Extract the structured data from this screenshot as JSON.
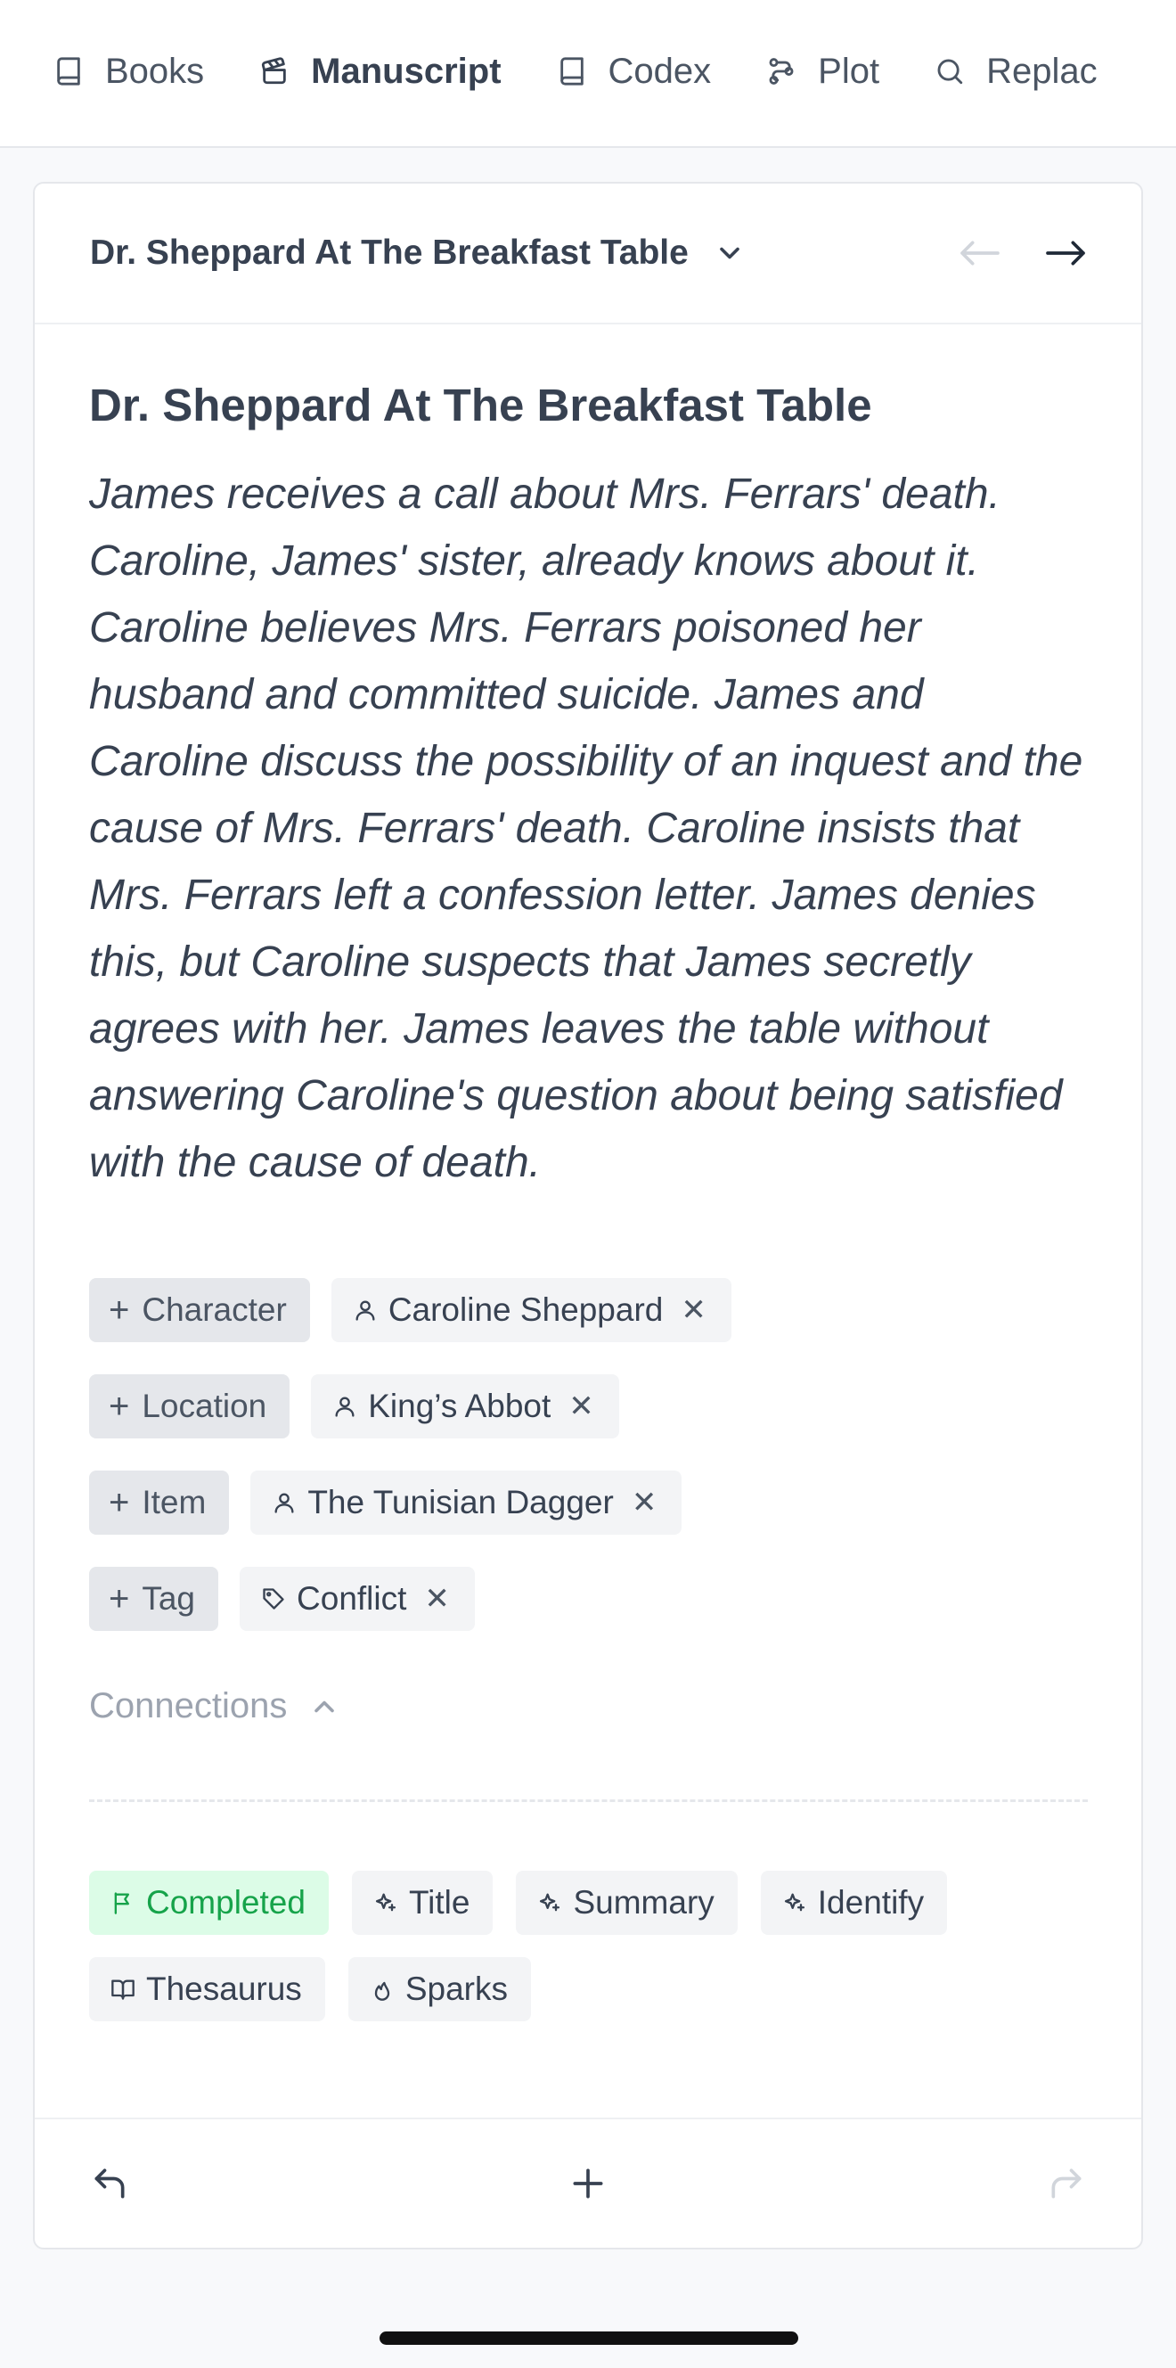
{
  "nav": {
    "items": [
      {
        "label": "Books",
        "icon": "book-icon"
      },
      {
        "label": "Manuscript",
        "icon": "clapperboard-icon",
        "active": true
      },
      {
        "label": "Codex",
        "icon": "book-icon"
      },
      {
        "label": "Plot",
        "icon": "route-icon"
      },
      {
        "label": "Replac",
        "icon": "search-icon"
      }
    ]
  },
  "header": {
    "scene_select": "Dr. Sheppard At The Breakfast Table"
  },
  "scene": {
    "title": "Dr. Sheppard At The Breakfast Table",
    "summary": "James receives a call about Mrs. Ferrars' death. Caroline, James' sister, already knows about it. Caroline believes Mrs. Ferrars poisoned her husband and committed suicide. James and Caroline discuss the possibility of an inquest and the cause of Mrs. Ferrars' death. Caroline insists that Mrs. Ferrars left a confession letter. James denies this, but Caroline suspects that James secretly agrees with her. James leaves the table without answering Caroline's question about being satisfied with the cause of death."
  },
  "tags": {
    "character": {
      "add_label": "Character",
      "items": [
        "Caroline Sheppard"
      ]
    },
    "location": {
      "add_label": "Location",
      "items": [
        "King’s Abbot"
      ]
    },
    "item": {
      "add_label": "Item",
      "items": [
        "The Tunisian Dagger"
      ]
    },
    "tag": {
      "add_label": "Tag",
      "items": [
        "Conflict"
      ]
    }
  },
  "connections": {
    "label": "Connections"
  },
  "actions": {
    "completed": "Completed",
    "title": "Title",
    "summary": "Summary",
    "identify": "Identify",
    "thesaurus": "Thesaurus",
    "sparks": "Sparks"
  },
  "colors": {
    "completed_bg": "#dcfce7",
    "completed_text": "#16a34a",
    "chip_bg": "#f3f4f6",
    "add_chip_bg": "#e5e7eb"
  }
}
